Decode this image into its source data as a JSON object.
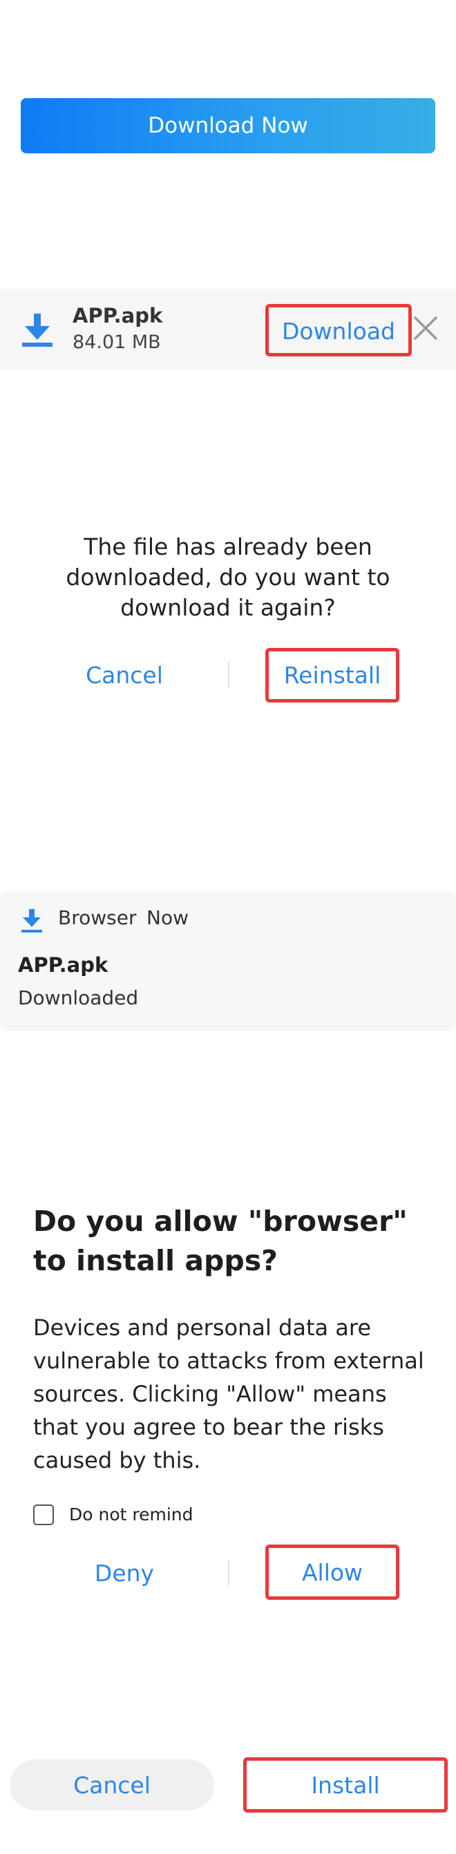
{
  "banner": {
    "download_now_label": "Download Now"
  },
  "download_bar": {
    "file_name": "APP.apk",
    "file_size": "84.01 MB",
    "download_label": "Download"
  },
  "reinstall_dialog": {
    "message": "The file has already been downloaded, do you want to download it again?",
    "cancel_label": "Cancel",
    "reinstall_label": "Reinstall"
  },
  "notification": {
    "app_name": "Browser",
    "time": "Now",
    "title": "APP.apk",
    "status": "Downloaded"
  },
  "permission_dialog": {
    "title": "Do you allow \"browser\" to install apps?",
    "body": "Devices and personal data are vulnerable to attacks from external sources. Clicking \"Allow\" means that you agree to bear the risks caused by this.",
    "checkbox_label": "Do not remind",
    "checkbox_checked": false,
    "deny_label": "Deny",
    "allow_label": "Allow"
  },
  "install_footer": {
    "cancel_label": "Cancel",
    "install_label": "Install"
  },
  "colors": {
    "accent": "#2b86e8",
    "highlight": "#e8393b",
    "banner_start": "#0f7bf5",
    "banner_end": "#36aee6"
  },
  "icons": [
    "download-icon",
    "close-icon",
    "checkbox-icon"
  ]
}
